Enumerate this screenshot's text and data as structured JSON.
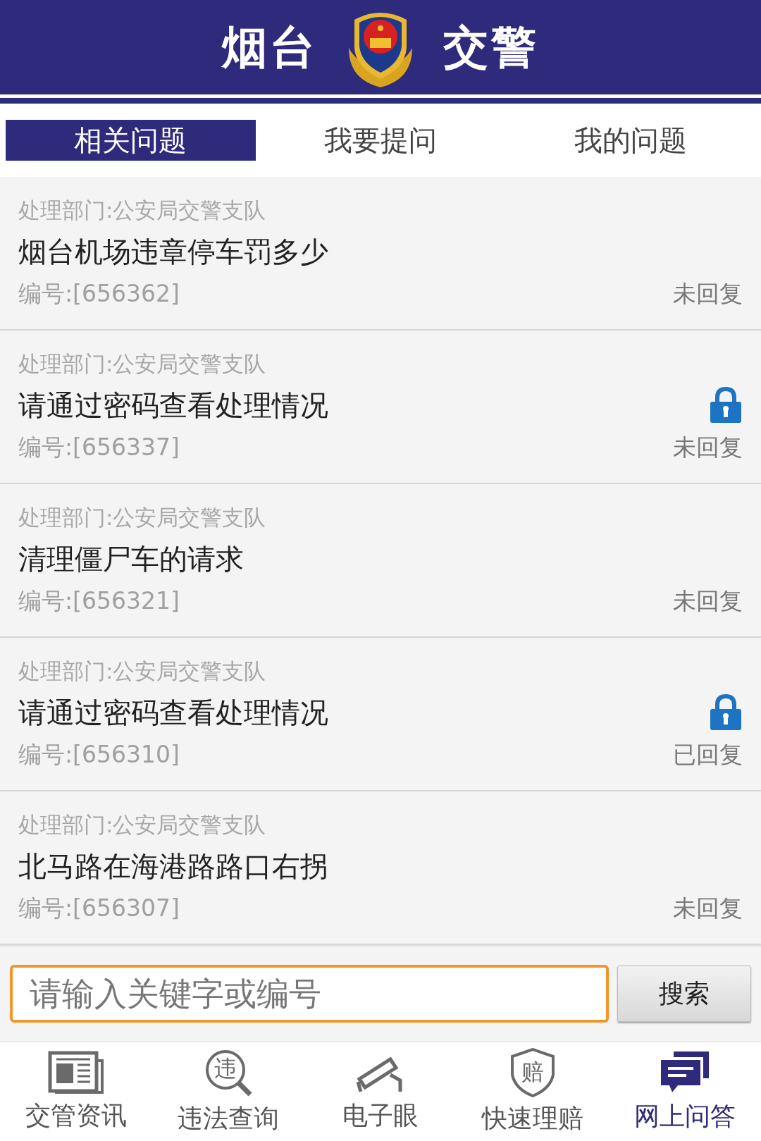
{
  "header": {
    "title_left": "烟台",
    "title_right": "交警"
  },
  "tabs": [
    {
      "label": "相关问题",
      "selected": true
    },
    {
      "label": "我要提问",
      "selected": false
    },
    {
      "label": "我的问题",
      "selected": false
    }
  ],
  "questions": [
    {
      "department": "处理部门:公安局交警支队",
      "title": "烟台机场违章停车罚多少",
      "number": "编号:[656362]",
      "status": "未回复",
      "locked": false
    },
    {
      "department": "处理部门:公安局交警支队",
      "title": "请通过密码查看处理情况",
      "number": "编号:[656337]",
      "status": "未回复",
      "locked": true
    },
    {
      "department": "处理部门:公安局交警支队",
      "title": "清理僵尸车的请求",
      "number": "编号:[656321]",
      "status": "未回复",
      "locked": false
    },
    {
      "department": "处理部门:公安局交警支队",
      "title": "请通过密码查看处理情况",
      "number": "编号:[656310]",
      "status": "已回复",
      "locked": true
    },
    {
      "department": "处理部门:公安局交警支队",
      "title": "北马路在海港路路口右拐",
      "number": "编号:[656307]",
      "status": "未回复",
      "locked": false
    }
  ],
  "search": {
    "placeholder": "请输入关键字或编号",
    "button": "搜索"
  },
  "nav": [
    {
      "label": "交管资讯",
      "kind": "news",
      "selected": false
    },
    {
      "label": "违法查询",
      "kind": "violation",
      "icon_text": "违",
      "selected": false
    },
    {
      "label": "电子眼",
      "kind": "camera",
      "selected": false
    },
    {
      "label": "快速理赔",
      "kind": "claim",
      "icon_text": "赔",
      "selected": false
    },
    {
      "label": "网上问答",
      "kind": "chat",
      "selected": true
    }
  ]
}
